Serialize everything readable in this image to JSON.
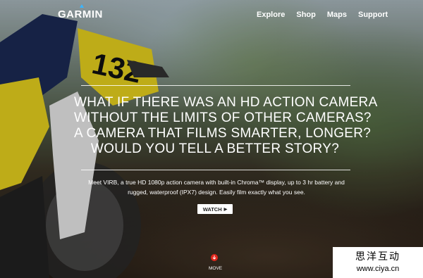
{
  "header": {
    "logo_text": "GARMIN",
    "nav": [
      {
        "label": "Explore"
      },
      {
        "label": "Shop"
      },
      {
        "label": "Maps"
      },
      {
        "label": "Support"
      }
    ]
  },
  "hero": {
    "headline_lines": [
      "WHAT IF THERE WAS AN HD ACTION CAMERA",
      "WITHOUT THE LIMITS OF OTHER CAMERAS?",
      "A CAMERA THAT FILMS SMARTER, LONGER?",
      "WOULD YOU TELL A BETTER STORY?"
    ],
    "description_line1": "Meet VIRB, a true HD 1080p action camera with built-in Chroma™ display, up to 3 hr battery and",
    "description_line2": "rugged, waterproof (IPX7) design. Easily film exactly what you see.",
    "watch_label": "WATCH",
    "watch_arrow": "▶",
    "move_label": "MOVE",
    "rider_number": "132"
  },
  "watermark": {
    "chinese": "思洋互动",
    "url": "www.ciya.cn"
  },
  "colors": {
    "accent": "#e0261b",
    "logo_triangle": "#3ab5ff",
    "bike_yellow": "#e8d21e"
  }
}
